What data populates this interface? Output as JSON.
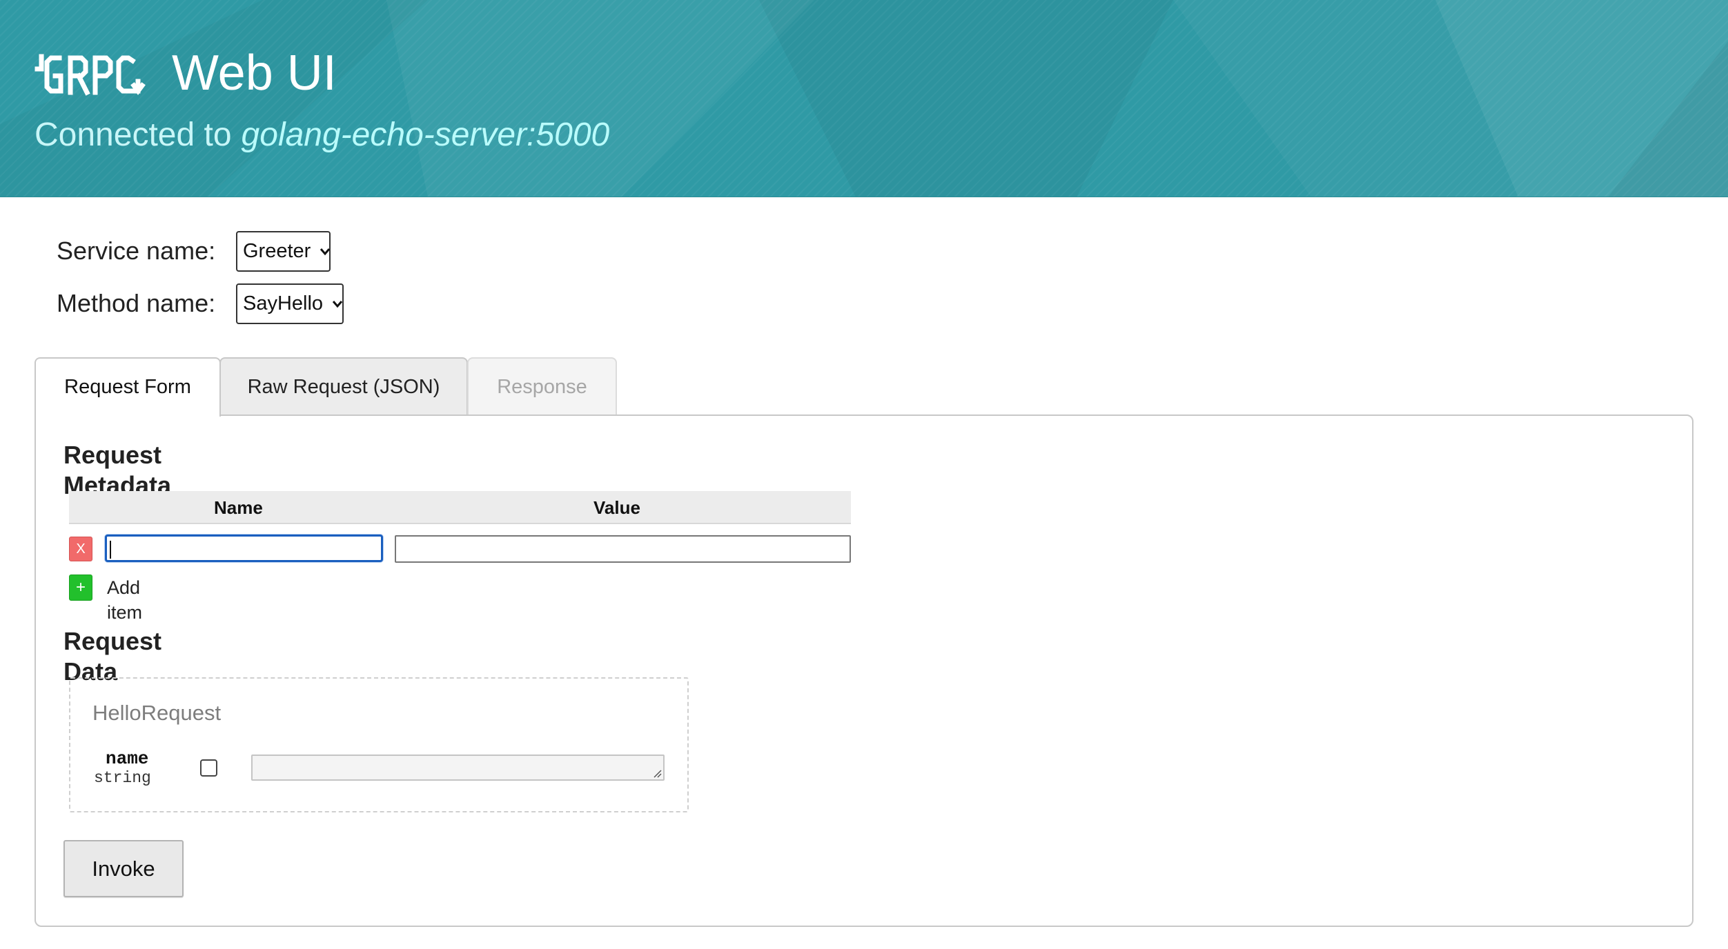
{
  "header": {
    "logo_text": "GRPC",
    "title": "Web UI",
    "connected_prefix": "Connected to",
    "server_address": "golang-echo-server:5000"
  },
  "selectors": {
    "service_label": "Service name:",
    "service_value": "Greeter",
    "method_label": "Method name:",
    "method_value": "SayHello"
  },
  "tabs": [
    {
      "label": "Request Form",
      "state": "active"
    },
    {
      "label": "Raw Request (JSON)",
      "state": "inactive"
    },
    {
      "label": "Response",
      "state": "disabled"
    }
  ],
  "metadata": {
    "title": "Request Metadata",
    "columns": [
      "Name",
      "Value"
    ],
    "rows": [
      {
        "name": "",
        "value": ""
      }
    ],
    "delete_label": "X",
    "add_icon": "+",
    "add_label": "Add item"
  },
  "request_data": {
    "title": "Request Data",
    "message_type": "HelloRequest",
    "fields": [
      {
        "name": "name",
        "type": "string",
        "checked": false,
        "value": ""
      }
    ]
  },
  "invoke_label": "Invoke",
  "colors": {
    "header_bg": "#2f9aa5",
    "delete_red": "#f16a6a",
    "add_green": "#22c02c",
    "focus_blue": "#1a5fbf"
  }
}
